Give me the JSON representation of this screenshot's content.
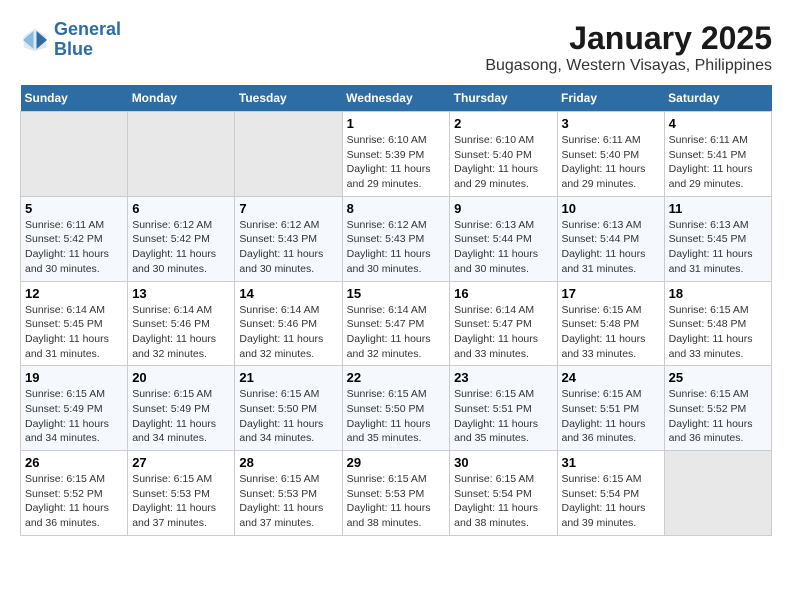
{
  "header": {
    "logo_line1": "General",
    "logo_line2": "Blue",
    "month_year": "January 2025",
    "location": "Bugasong, Western Visayas, Philippines"
  },
  "weekdays": [
    "Sunday",
    "Monday",
    "Tuesday",
    "Wednesday",
    "Thursday",
    "Friday",
    "Saturday"
  ],
  "weeks": [
    [
      {
        "day": "",
        "info": ""
      },
      {
        "day": "",
        "info": ""
      },
      {
        "day": "",
        "info": ""
      },
      {
        "day": "1",
        "info": "Sunrise: 6:10 AM\nSunset: 5:39 PM\nDaylight: 11 hours and 29 minutes."
      },
      {
        "day": "2",
        "info": "Sunrise: 6:10 AM\nSunset: 5:40 PM\nDaylight: 11 hours and 29 minutes."
      },
      {
        "day": "3",
        "info": "Sunrise: 6:11 AM\nSunset: 5:40 PM\nDaylight: 11 hours and 29 minutes."
      },
      {
        "day": "4",
        "info": "Sunrise: 6:11 AM\nSunset: 5:41 PM\nDaylight: 11 hours and 29 minutes."
      }
    ],
    [
      {
        "day": "5",
        "info": "Sunrise: 6:11 AM\nSunset: 5:42 PM\nDaylight: 11 hours and 30 minutes."
      },
      {
        "day": "6",
        "info": "Sunrise: 6:12 AM\nSunset: 5:42 PM\nDaylight: 11 hours and 30 minutes."
      },
      {
        "day": "7",
        "info": "Sunrise: 6:12 AM\nSunset: 5:43 PM\nDaylight: 11 hours and 30 minutes."
      },
      {
        "day": "8",
        "info": "Sunrise: 6:12 AM\nSunset: 5:43 PM\nDaylight: 11 hours and 30 minutes."
      },
      {
        "day": "9",
        "info": "Sunrise: 6:13 AM\nSunset: 5:44 PM\nDaylight: 11 hours and 30 minutes."
      },
      {
        "day": "10",
        "info": "Sunrise: 6:13 AM\nSunset: 5:44 PM\nDaylight: 11 hours and 31 minutes."
      },
      {
        "day": "11",
        "info": "Sunrise: 6:13 AM\nSunset: 5:45 PM\nDaylight: 11 hours and 31 minutes."
      }
    ],
    [
      {
        "day": "12",
        "info": "Sunrise: 6:14 AM\nSunset: 5:45 PM\nDaylight: 11 hours and 31 minutes."
      },
      {
        "day": "13",
        "info": "Sunrise: 6:14 AM\nSunset: 5:46 PM\nDaylight: 11 hours and 32 minutes."
      },
      {
        "day": "14",
        "info": "Sunrise: 6:14 AM\nSunset: 5:46 PM\nDaylight: 11 hours and 32 minutes."
      },
      {
        "day": "15",
        "info": "Sunrise: 6:14 AM\nSunset: 5:47 PM\nDaylight: 11 hours and 32 minutes."
      },
      {
        "day": "16",
        "info": "Sunrise: 6:14 AM\nSunset: 5:47 PM\nDaylight: 11 hours and 33 minutes."
      },
      {
        "day": "17",
        "info": "Sunrise: 6:15 AM\nSunset: 5:48 PM\nDaylight: 11 hours and 33 minutes."
      },
      {
        "day": "18",
        "info": "Sunrise: 6:15 AM\nSunset: 5:48 PM\nDaylight: 11 hours and 33 minutes."
      }
    ],
    [
      {
        "day": "19",
        "info": "Sunrise: 6:15 AM\nSunset: 5:49 PM\nDaylight: 11 hours and 34 minutes."
      },
      {
        "day": "20",
        "info": "Sunrise: 6:15 AM\nSunset: 5:49 PM\nDaylight: 11 hours and 34 minutes."
      },
      {
        "day": "21",
        "info": "Sunrise: 6:15 AM\nSunset: 5:50 PM\nDaylight: 11 hours and 34 minutes."
      },
      {
        "day": "22",
        "info": "Sunrise: 6:15 AM\nSunset: 5:50 PM\nDaylight: 11 hours and 35 minutes."
      },
      {
        "day": "23",
        "info": "Sunrise: 6:15 AM\nSunset: 5:51 PM\nDaylight: 11 hours and 35 minutes."
      },
      {
        "day": "24",
        "info": "Sunrise: 6:15 AM\nSunset: 5:51 PM\nDaylight: 11 hours and 36 minutes."
      },
      {
        "day": "25",
        "info": "Sunrise: 6:15 AM\nSunset: 5:52 PM\nDaylight: 11 hours and 36 minutes."
      }
    ],
    [
      {
        "day": "26",
        "info": "Sunrise: 6:15 AM\nSunset: 5:52 PM\nDaylight: 11 hours and 36 minutes."
      },
      {
        "day": "27",
        "info": "Sunrise: 6:15 AM\nSunset: 5:53 PM\nDaylight: 11 hours and 37 minutes."
      },
      {
        "day": "28",
        "info": "Sunrise: 6:15 AM\nSunset: 5:53 PM\nDaylight: 11 hours and 37 minutes."
      },
      {
        "day": "29",
        "info": "Sunrise: 6:15 AM\nSunset: 5:53 PM\nDaylight: 11 hours and 38 minutes."
      },
      {
        "day": "30",
        "info": "Sunrise: 6:15 AM\nSunset: 5:54 PM\nDaylight: 11 hours and 38 minutes."
      },
      {
        "day": "31",
        "info": "Sunrise: 6:15 AM\nSunset: 5:54 PM\nDaylight: 11 hours and 39 minutes."
      },
      {
        "day": "",
        "info": ""
      }
    ]
  ]
}
